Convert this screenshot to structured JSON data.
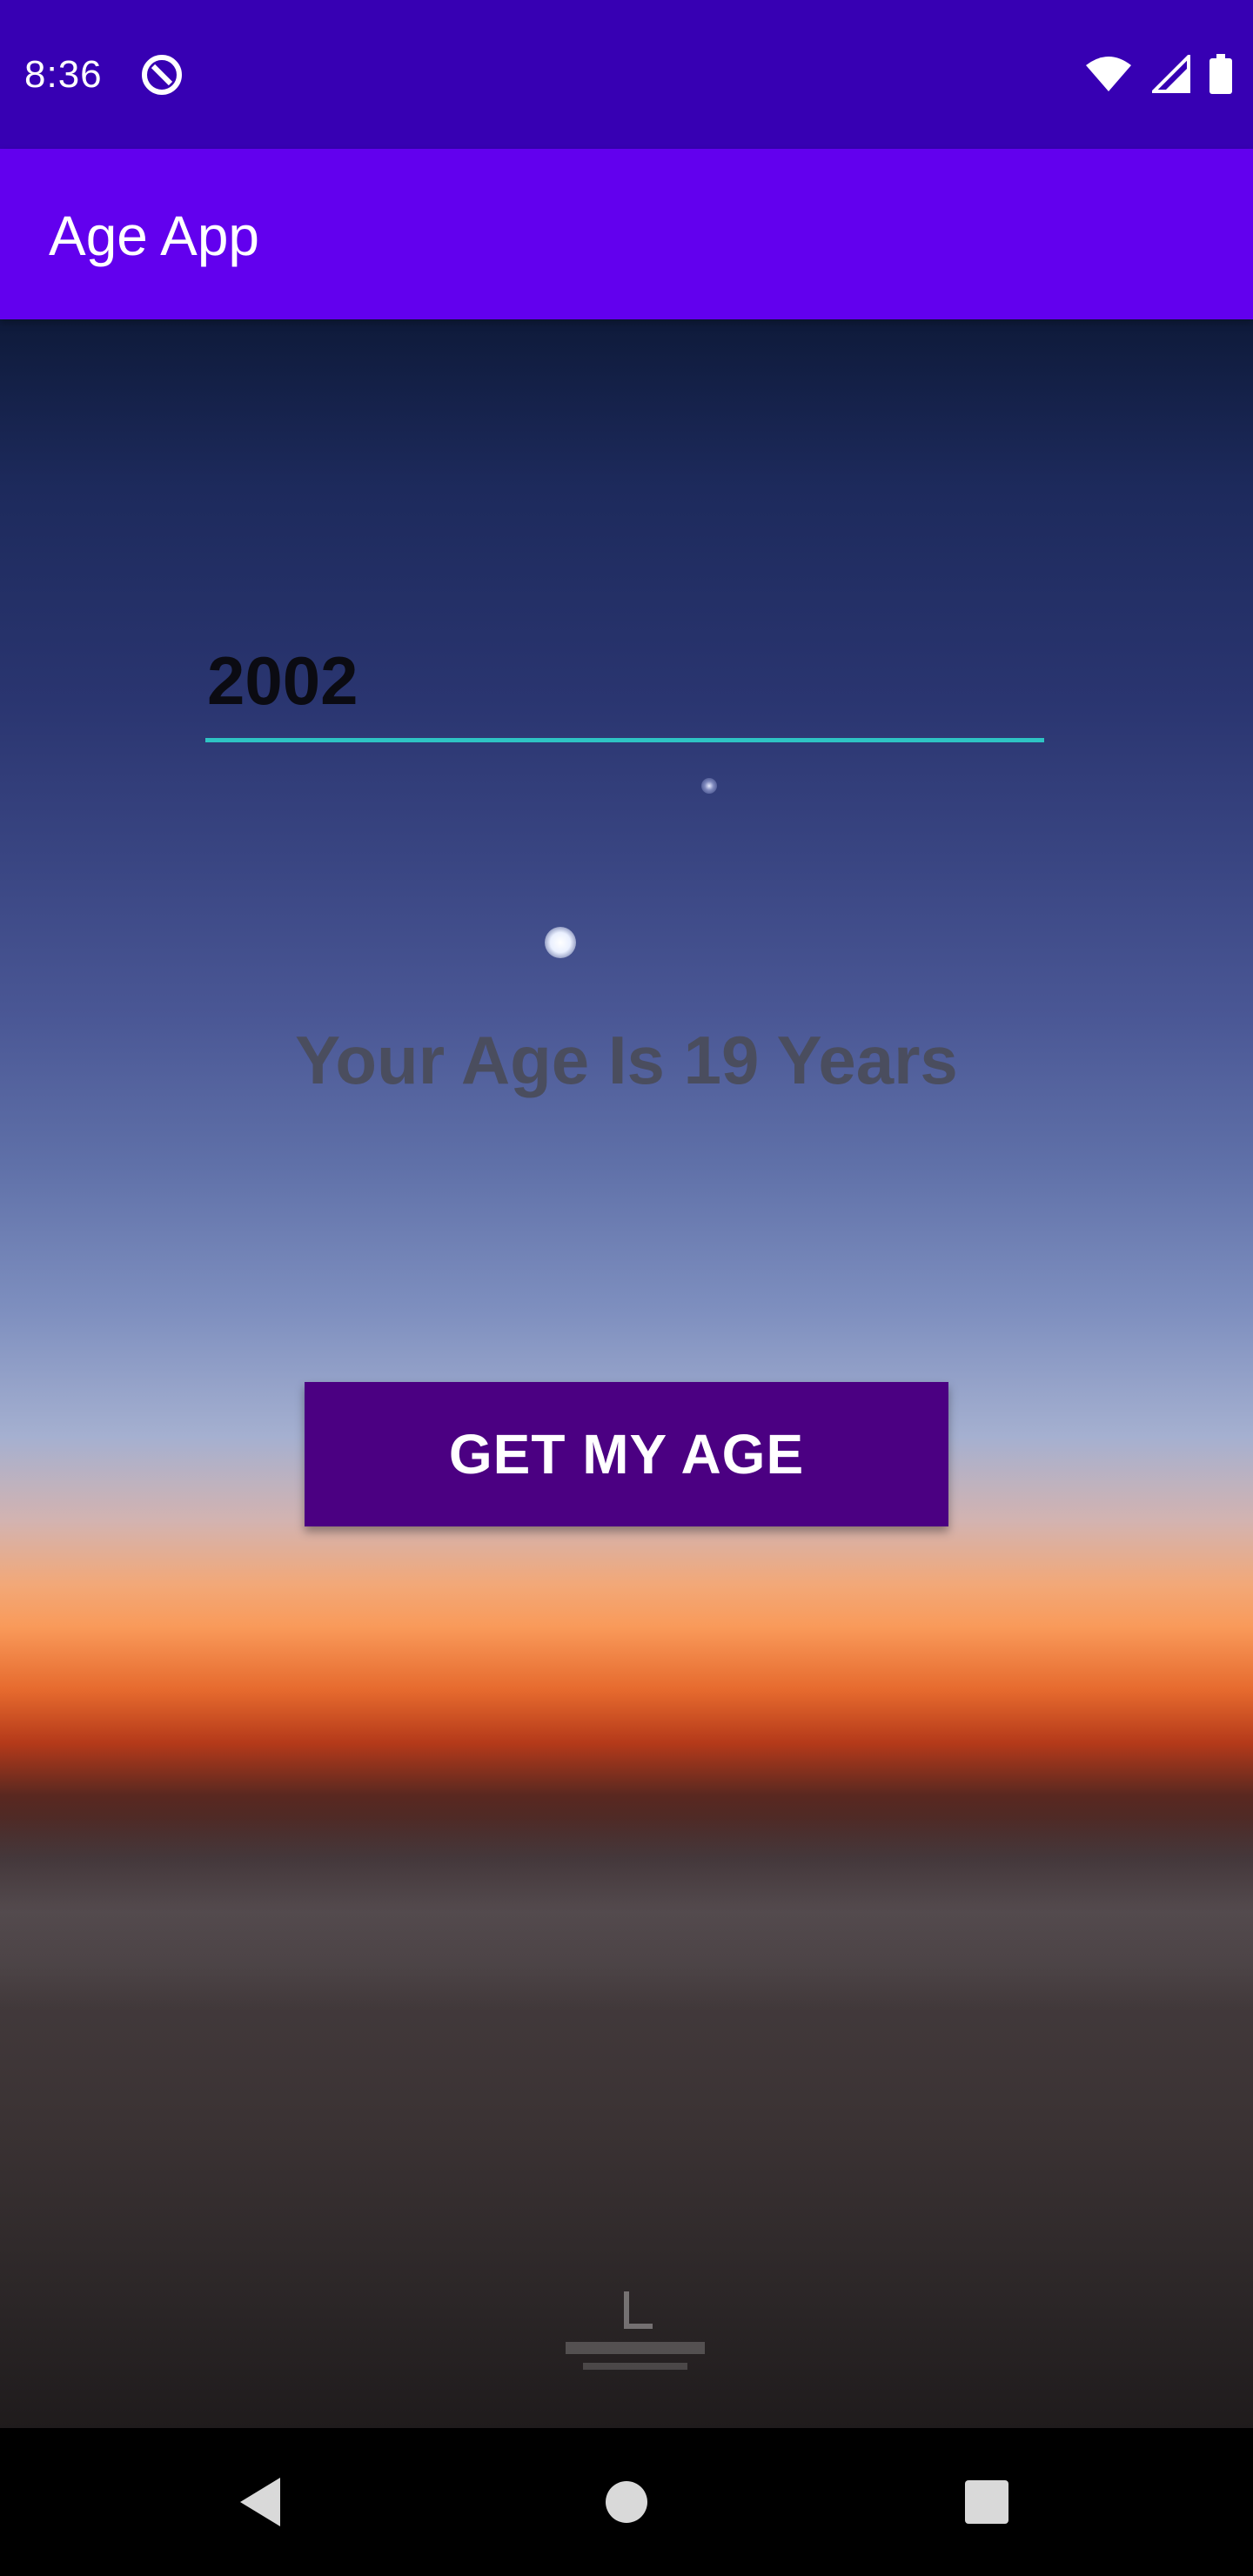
{
  "status_bar": {
    "time": "8:36",
    "icons": [
      "app-notification-icon",
      "wifi-icon",
      "signal-icon",
      "battery-icon"
    ]
  },
  "app_bar": {
    "title": "Age App"
  },
  "form": {
    "year_value": "2002",
    "accent_color": "#2ec4c4"
  },
  "result": {
    "text": "Your Age Is 19 Years"
  },
  "button": {
    "label": "GET MY AGE",
    "color": "#4b0082"
  },
  "nav_bar": {
    "icons": [
      "back-icon",
      "home-icon",
      "recents-icon"
    ]
  },
  "colors": {
    "status_bar": "#3700b3",
    "app_bar": "#6200ee"
  }
}
